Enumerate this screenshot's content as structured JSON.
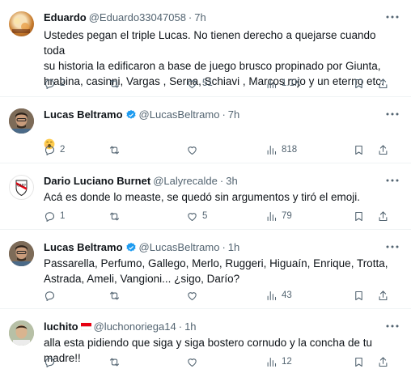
{
  "tweets": [
    {
      "name": "Eduardo",
      "handle": "@Eduardo33047058",
      "dot": "·",
      "time": "7h",
      "text": "Ustedes pegan el triple Lucas. No tienen derecho a quejarse cuando toda\nsu historia la edificaron a base de juego brusco propinado por Giunta,\nhrabina, casinni, Vargas , Serna, Schiavi , Marcos rojo y un eterno etc.",
      "replies": "2",
      "retweets": "",
      "likes": "51",
      "views": "1.1K"
    },
    {
      "name": "Lucas Beltramo",
      "handle": "@LucasBeltramo",
      "dot": "·",
      "time": "7h",
      "text": "",
      "emoji": "yawning-face",
      "replies": "2",
      "retweets": "",
      "likes": "",
      "views": "818"
    },
    {
      "name": "Dario Luciano Burnet",
      "handle": "@Lalyrecalde",
      "dot": "·",
      "time": "3h",
      "text": "Acá es donde lo measte, se quedó sin argumentos y tiró el emoji.",
      "replies": "1",
      "retweets": "",
      "likes": "5",
      "views": "79"
    },
    {
      "name": "Lucas Beltramo",
      "handle": "@LucasBeltramo",
      "dot": "·",
      "time": "1h",
      "text": "Passarella, Perfumo, Gallego, Merlo, Ruggeri, Higuaín, Enrique, Trotta,\nAstrada, Ameli, Vangioni... ¿sigo, Darío?",
      "replies": "",
      "retweets": "",
      "likes": "",
      "views": "43"
    },
    {
      "name": "luchito",
      "handle": "@luchonoriega14",
      "dot": "·",
      "time": "1h",
      "text": "alla esta pidiendo que siga y siga bostero cornudo y la concha de tu madre!!",
      "replies": "",
      "retweets": "",
      "likes": "",
      "views": "12"
    }
  ],
  "colors": {
    "verified": "#1d9bf0",
    "muted": "#536471",
    "text": "#0f1419",
    "divider": "#eff3f4"
  }
}
